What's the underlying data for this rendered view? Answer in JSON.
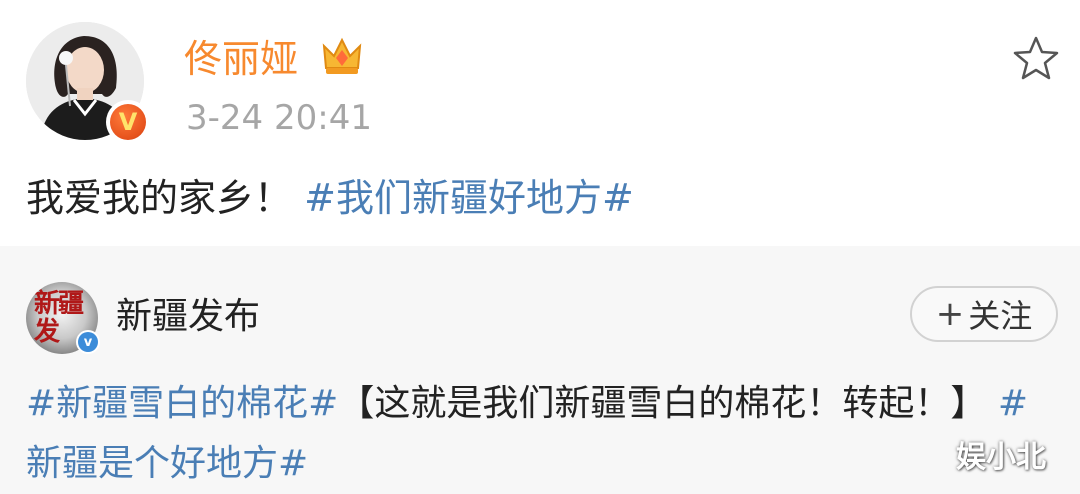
{
  "post": {
    "username": "佟丽娅",
    "timestamp": "3-24 20:41",
    "text_plain": "我爱我的家乡！",
    "text_topic": "#我们新疆好地方#",
    "icons": [
      "avatar",
      "verified-badge-icon",
      "crown-icon",
      "star-icon"
    ]
  },
  "repost": {
    "username": "新疆发布",
    "avatar_text": "新疆发",
    "follow_label": "关注",
    "follow_icon": "+",
    "topic1": "#新疆雪白的棉花#",
    "body": "【这就是我们新疆雪白的棉花！转起！】",
    "topic2": "#新疆是个好地方#"
  },
  "watermark": "娱小北",
  "colors": {
    "username_orange": "#f7892e",
    "topic_blue": "#4a7eb5",
    "timestamp_gray": "#a6a6a6",
    "repost_bg": "#f7f7f7"
  }
}
